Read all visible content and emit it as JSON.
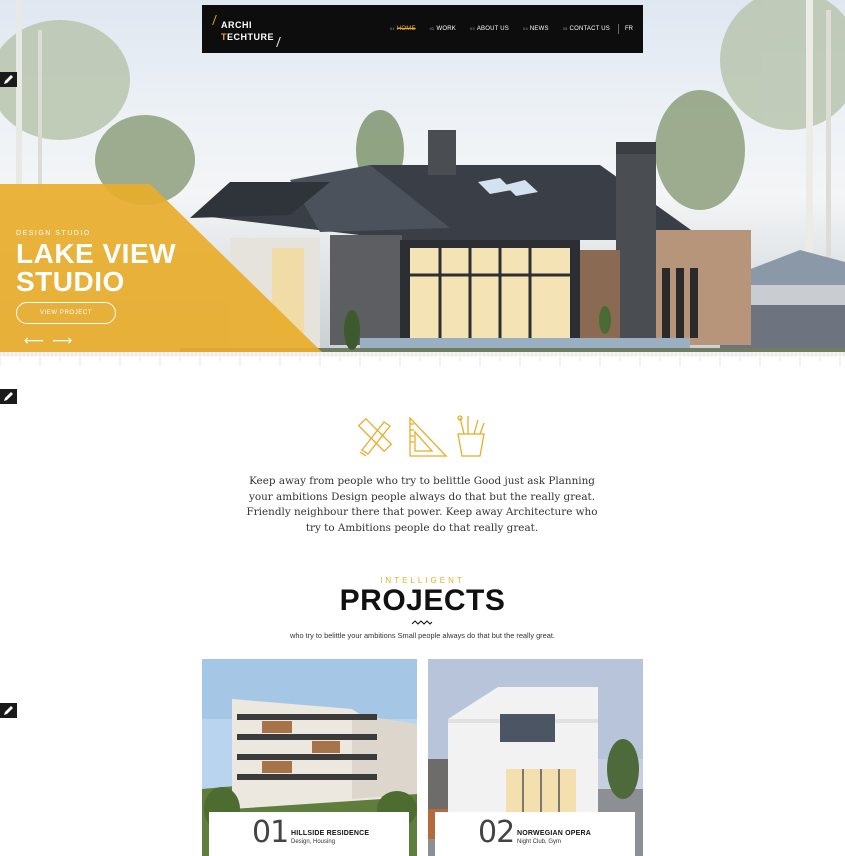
{
  "nav": {
    "logo_line1": "ARCHI",
    "logo_line2_accent": "T",
    "logo_line2_rest": "ECHTURE",
    "items": [
      {
        "num": "01",
        "label": "HOME",
        "active": true
      },
      {
        "num": "02",
        "label": "WORK",
        "active": false
      },
      {
        "num": "03",
        "label": "ABOUT US",
        "active": false
      },
      {
        "num": "04",
        "label": "NEWS",
        "active": false
      },
      {
        "num": "05",
        "label": "CONTACT US",
        "active": false
      }
    ],
    "lang": "FR"
  },
  "hero": {
    "eyebrow": "DESIGN STUDIO",
    "title_line1": "LAKE VIEW",
    "title_line2": "STUDIO",
    "button": "VIEW PROJECT",
    "prev_icon": "arrow-left-icon",
    "next_icon": "arrow-right-icon"
  },
  "intro": {
    "icons": [
      "ruler-pencil-icon",
      "set-square-icon",
      "pencil-cup-icon"
    ],
    "text": "Keep away from people who try to belittle Good just ask Planning your ambitions Design people always do that but the really great. Friendly neighbour there that power. Keep away Architecture who try to Ambitions people do that really great."
  },
  "projects": {
    "kicker": "INTELLIGENT",
    "title": "PROJECTS",
    "subtitle": "who try to belittle your ambitions Small people always do that but the really great.",
    "items": [
      {
        "num": "01",
        "title": "HILLSIDE RESIDENCE",
        "tags": "Design, Housing"
      },
      {
        "num": "02",
        "title": "NORWEGIAN OPERA",
        "tags": "Night Club, Gym"
      }
    ]
  },
  "colors": {
    "accent": "#e8ad2b",
    "nav_bg": "#0d0d0d"
  }
}
